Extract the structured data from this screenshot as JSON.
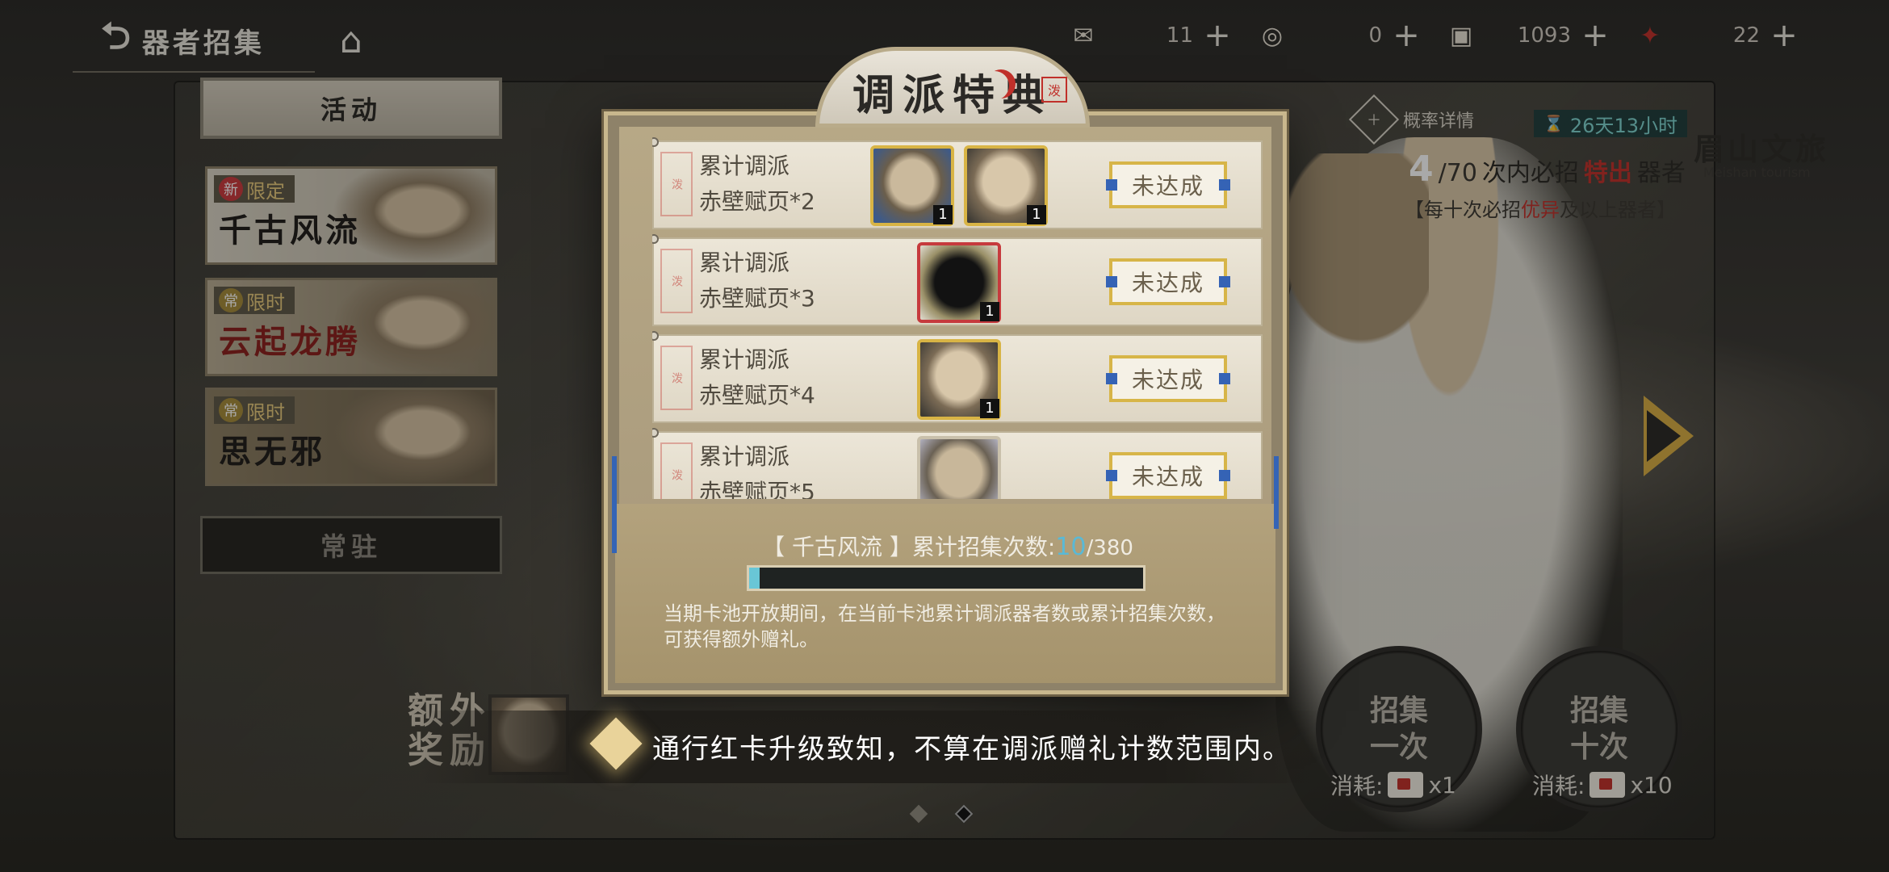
{
  "header": {
    "title": "器者招集",
    "currencies": [
      {
        "icon": "envelope-ticket-icon",
        "value": "11"
      },
      {
        "icon": "coin-pouch-icon",
        "value": "0"
      },
      {
        "icon": "jade-token-icon",
        "value": "1093"
      },
      {
        "icon": "red-seal-icon",
        "value": "22"
      }
    ],
    "plus": "+"
  },
  "sidebar": {
    "activity_tab": "活动",
    "banners": [
      {
        "tag": "限定",
        "tag_icon": "新",
        "name": "千古风流"
      },
      {
        "tag": "限时",
        "tag_icon": "常",
        "name": "云起龙腾"
      },
      {
        "tag": "限时",
        "tag_icon": "常",
        "name": "思无邪"
      }
    ],
    "permanent_tab": "常驻"
  },
  "info": {
    "rate_details": "概率详情",
    "countdown": "26天13小时",
    "pity_current": "4",
    "pity_total": "/70",
    "pity_text_a": "次内必招",
    "pity_text_red": "特出",
    "pity_text_b": "器者",
    "pity_sub_a": "【每十次必招",
    "pity_sub_red": "优异",
    "pity_sub_b": "及以上器者】",
    "logo": "眉山文旅",
    "logo_sub": "Meishan tourism"
  },
  "pull": {
    "single_line1": "招集",
    "single_line2": "一次",
    "ten_line1": "招集",
    "ten_line2": "十次",
    "cost_label": "消耗:",
    "single_cost": "x1",
    "ten_cost": "x10"
  },
  "extra_reward": {
    "label_line1": "额外",
    "label_line2": "奖励"
  },
  "modal": {
    "title": "调派特典",
    "seal": "泼",
    "rows": [
      {
        "cond_line1": "累计调派",
        "cond_line2": "赤壁赋页*2",
        "status": "未达成",
        "items": [
          {
            "kind": "blue",
            "count": "1"
          },
          {
            "kind": "normal",
            "count": "1"
          }
        ]
      },
      {
        "cond_line1": "累计调派",
        "cond_line2": "赤壁赋页*3",
        "status": "未达成",
        "items": [
          {
            "kind": "red",
            "count": "1"
          }
        ]
      },
      {
        "cond_line1": "累计调派",
        "cond_line2": "赤壁赋页*4",
        "status": "未达成",
        "items": [
          {
            "kind": "normal",
            "count": "1"
          }
        ]
      },
      {
        "cond_line1": "累计调派",
        "cond_line2": "赤壁赋页*5",
        "status": "未达成",
        "items": [
          {
            "kind": "light",
            "count": ""
          }
        ]
      }
    ],
    "progress_prefix": "【 千古风流 】累计招集次数:",
    "progress_current": "10",
    "progress_total": "/380",
    "progress_fraction": 0.026,
    "description": "当期卡池开放期间，在当前卡池累计调派器者数或累计招集次数，可获得额外赠礼。"
  },
  "toast": {
    "text": "通行红卡升级致知，不算在调派赠礼计数范围内。"
  },
  "colors": {
    "accent_gold": "#d7b548",
    "accent_red": "#c0302a",
    "progress_cyan": "#69c6d6",
    "status_blue": "#3563b5"
  }
}
